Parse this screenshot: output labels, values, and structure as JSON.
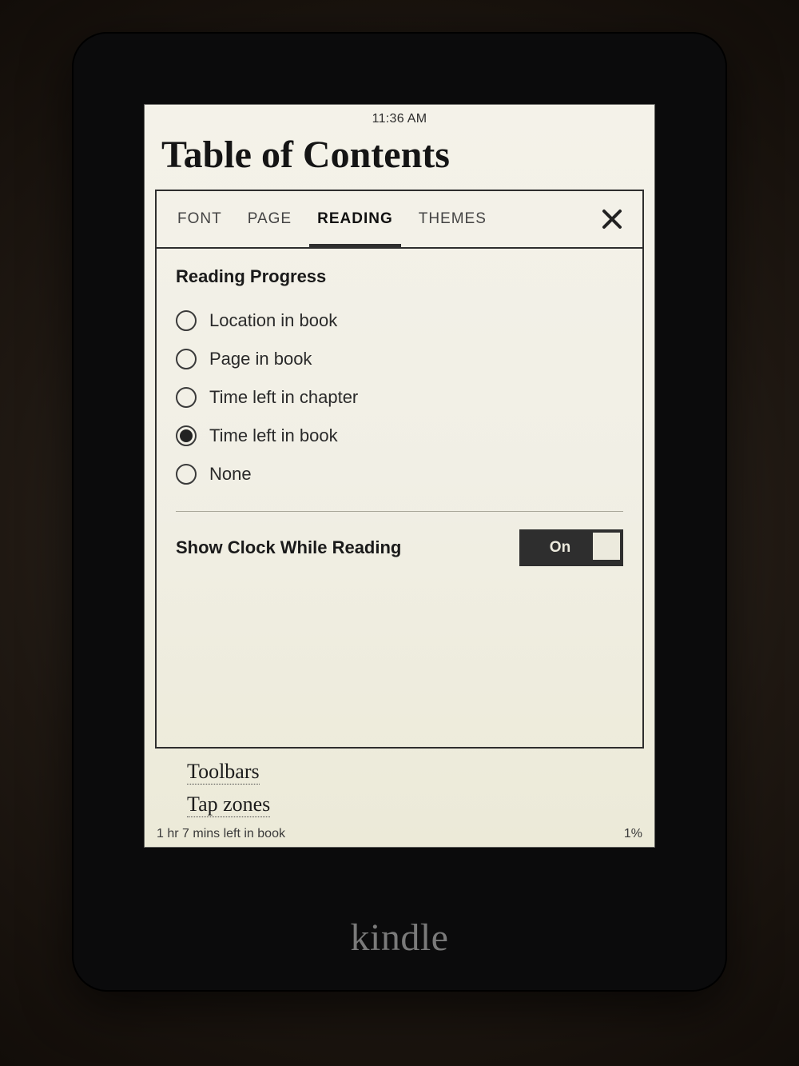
{
  "status": {
    "time": "11:36 AM"
  },
  "page": {
    "title": "Table of Contents"
  },
  "tabs": {
    "items": [
      {
        "label": "FONT",
        "active": false
      },
      {
        "label": "PAGE",
        "active": false
      },
      {
        "label": "READING",
        "active": true
      },
      {
        "label": "THEMES",
        "active": false
      }
    ]
  },
  "reading_progress": {
    "title": "Reading Progress",
    "options": [
      {
        "label": "Location in book",
        "selected": false
      },
      {
        "label": "Page in book",
        "selected": false
      },
      {
        "label": "Time left in chapter",
        "selected": false
      },
      {
        "label": "Time left in book",
        "selected": true
      },
      {
        "label": "None",
        "selected": false
      }
    ]
  },
  "show_clock": {
    "label": "Show Clock While Reading",
    "state_text": "On",
    "value": true
  },
  "links": [
    {
      "label": "Toolbars"
    },
    {
      "label": "Tap zones"
    }
  ],
  "footer": {
    "left": "1 hr 7 mins left in book",
    "right": "1%"
  },
  "device": {
    "brand": "kindle"
  }
}
